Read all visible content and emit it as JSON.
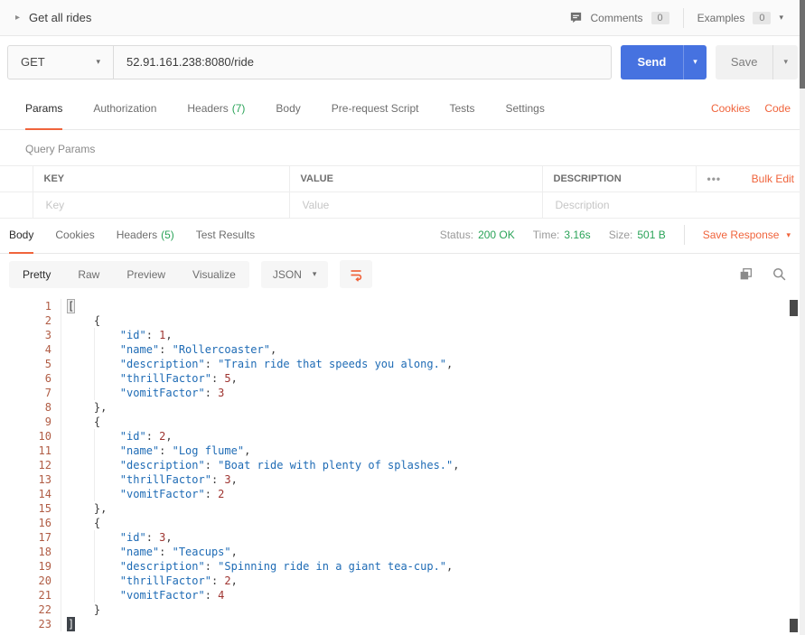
{
  "colors": {
    "accent_orange": "#F0643C",
    "success_green": "#2AA358",
    "send_button_blue": "#4672E0",
    "code_key_string_blue": "#1E6BB5",
    "code_number_maroon": "#9E3430",
    "code_line_number_rust": "#B05C44"
  },
  "glyphs": {
    "caret_down": "▾",
    "caret_right": "▸",
    "more": "•••"
  },
  "topbar": {
    "title": "Get all rides",
    "comments_label": "Comments",
    "comments_count": "0",
    "examples_label": "Examples",
    "examples_count": "0"
  },
  "request": {
    "method": "GET",
    "url": "52.91.161.238:8080/ride",
    "send_label": "Send",
    "save_label": "Save",
    "cookies_link": "Cookies",
    "code_link": "Code"
  },
  "request_tabs": [
    {
      "label": "Params",
      "active": true
    },
    {
      "label": "Authorization"
    },
    {
      "label": "Headers",
      "count": "(7)"
    },
    {
      "label": "Body"
    },
    {
      "label": "Pre-request Script"
    },
    {
      "label": "Tests"
    },
    {
      "label": "Settings"
    }
  ],
  "query_params": {
    "title": "Query Params",
    "col_key": "KEY",
    "col_value": "VALUE",
    "col_description": "DESCRIPTION",
    "bulk_edit": "Bulk Edit",
    "ph_key": "Key",
    "ph_value": "Value",
    "ph_description": "Description"
  },
  "response": {
    "tabs": [
      {
        "label": "Body",
        "active": true
      },
      {
        "label": "Cookies"
      },
      {
        "label": "Headers",
        "count": "(5)"
      },
      {
        "label": "Test Results"
      }
    ],
    "status_label": "Status:",
    "status_value": "200 OK",
    "time_label": "Time:",
    "time_value": "3.16s",
    "size_label": "Size:",
    "size_value": "501 B",
    "save_response": "Save Response",
    "views": [
      {
        "label": "Pretty",
        "active": true
      },
      {
        "label": "Raw"
      },
      {
        "label": "Preview"
      },
      {
        "label": "Visualize"
      }
    ],
    "language": "JSON"
  },
  "code": {
    "lines": [
      {
        "t": [
          [
            "bo",
            "["
          ]
        ]
      },
      {
        "t": [
          [
            "p",
            "    {"
          ]
        ]
      },
      {
        "g": true,
        "t": [
          [
            "p",
            "        "
          ],
          [
            "s",
            "\"id\""
          ],
          [
            "p",
            ": "
          ],
          [
            "n",
            "1"
          ],
          [
            "p",
            ","
          ]
        ]
      },
      {
        "g": true,
        "t": [
          [
            "p",
            "        "
          ],
          [
            "s",
            "\"name\""
          ],
          [
            "p",
            ": "
          ],
          [
            "s",
            "\"Rollercoaster\""
          ],
          [
            "p",
            ","
          ]
        ]
      },
      {
        "g": true,
        "t": [
          [
            "p",
            "        "
          ],
          [
            "s",
            "\"description\""
          ],
          [
            "p",
            ": "
          ],
          [
            "s",
            "\"Train ride that speeds you along.\""
          ],
          [
            "p",
            ","
          ]
        ]
      },
      {
        "g": true,
        "t": [
          [
            "p",
            "        "
          ],
          [
            "s",
            "\"thrillFactor\""
          ],
          [
            "p",
            ": "
          ],
          [
            "n",
            "5"
          ],
          [
            "p",
            ","
          ]
        ]
      },
      {
        "g": true,
        "t": [
          [
            "p",
            "        "
          ],
          [
            "s",
            "\"vomitFactor\""
          ],
          [
            "p",
            ": "
          ],
          [
            "n",
            "3"
          ]
        ]
      },
      {
        "t": [
          [
            "p",
            "    },"
          ]
        ]
      },
      {
        "t": [
          [
            "p",
            "    {"
          ]
        ]
      },
      {
        "g": true,
        "t": [
          [
            "p",
            "        "
          ],
          [
            "s",
            "\"id\""
          ],
          [
            "p",
            ": "
          ],
          [
            "n",
            "2"
          ],
          [
            "p",
            ","
          ]
        ]
      },
      {
        "g": true,
        "t": [
          [
            "p",
            "        "
          ],
          [
            "s",
            "\"name\""
          ],
          [
            "p",
            ": "
          ],
          [
            "s",
            "\"Log flume\""
          ],
          [
            "p",
            ","
          ]
        ]
      },
      {
        "g": true,
        "t": [
          [
            "p",
            "        "
          ],
          [
            "s",
            "\"description\""
          ],
          [
            "p",
            ": "
          ],
          [
            "s",
            "\"Boat ride with plenty of splashes.\""
          ],
          [
            "p",
            ","
          ]
        ]
      },
      {
        "g": true,
        "t": [
          [
            "p",
            "        "
          ],
          [
            "s",
            "\"thrillFactor\""
          ],
          [
            "p",
            ": "
          ],
          [
            "n",
            "3"
          ],
          [
            "p",
            ","
          ]
        ]
      },
      {
        "g": true,
        "t": [
          [
            "p",
            "        "
          ],
          [
            "s",
            "\"vomitFactor\""
          ],
          [
            "p",
            ": "
          ],
          [
            "n",
            "2"
          ]
        ]
      },
      {
        "t": [
          [
            "p",
            "    },"
          ]
        ]
      },
      {
        "t": [
          [
            "p",
            "    {"
          ]
        ]
      },
      {
        "g": true,
        "t": [
          [
            "p",
            "        "
          ],
          [
            "s",
            "\"id\""
          ],
          [
            "p",
            ": "
          ],
          [
            "n",
            "3"
          ],
          [
            "p",
            ","
          ]
        ]
      },
      {
        "g": true,
        "t": [
          [
            "p",
            "        "
          ],
          [
            "s",
            "\"name\""
          ],
          [
            "p",
            ": "
          ],
          [
            "s",
            "\"Teacups\""
          ],
          [
            "p",
            ","
          ]
        ]
      },
      {
        "g": true,
        "t": [
          [
            "p",
            "        "
          ],
          [
            "s",
            "\"description\""
          ],
          [
            "p",
            ": "
          ],
          [
            "s",
            "\"Spinning ride in a giant tea-cup.\""
          ],
          [
            "p",
            ","
          ]
        ]
      },
      {
        "g": true,
        "t": [
          [
            "p",
            "        "
          ],
          [
            "s",
            "\"thrillFactor\""
          ],
          [
            "p",
            ": "
          ],
          [
            "n",
            "2"
          ],
          [
            "p",
            ","
          ]
        ]
      },
      {
        "g": true,
        "t": [
          [
            "p",
            "        "
          ],
          [
            "s",
            "\"vomitFactor\""
          ],
          [
            "p",
            ": "
          ],
          [
            "n",
            "4"
          ]
        ]
      },
      {
        "t": [
          [
            "p",
            "    }"
          ]
        ]
      },
      {
        "t": [
          [
            "bc",
            "]"
          ]
        ]
      }
    ]
  }
}
